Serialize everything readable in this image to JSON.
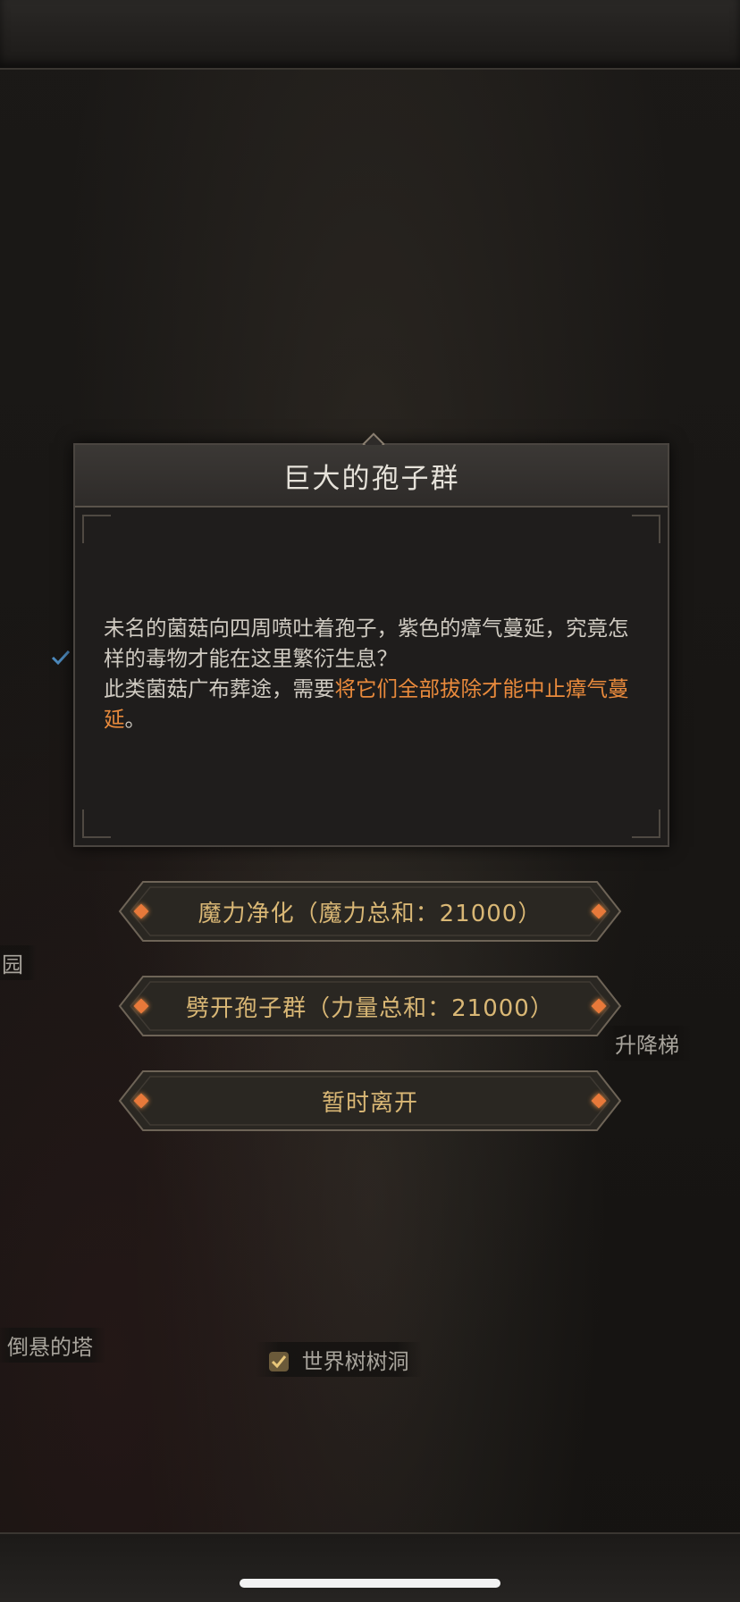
{
  "dialog": {
    "title": "巨大的孢子群",
    "text_plain_1": "未名的菌菇向四周喷吐着孢子，紫色的瘴气蔓延，究竟怎样的毒物才能在这里繁衍生息？",
    "text_plain_2": "此类菌菇广布葬途，需要",
    "text_highlight": "将它们全部拔除才能中止瘴气蔓延",
    "text_plain_3": "。"
  },
  "options": [
    {
      "label": "魔力净化（魔力总和：21000）"
    },
    {
      "label": "劈开孢子群（力量总和：21000）"
    },
    {
      "label": "暂时离开"
    }
  ],
  "map_labels": {
    "left_edge": "园",
    "elevator": "升降梯",
    "hanging_tower": "倒悬的塔",
    "world_tree": "世界树树洞"
  },
  "colors": {
    "highlight": "#e98a3c",
    "button_text": "#d9b775",
    "gem": "#e8793a"
  }
}
